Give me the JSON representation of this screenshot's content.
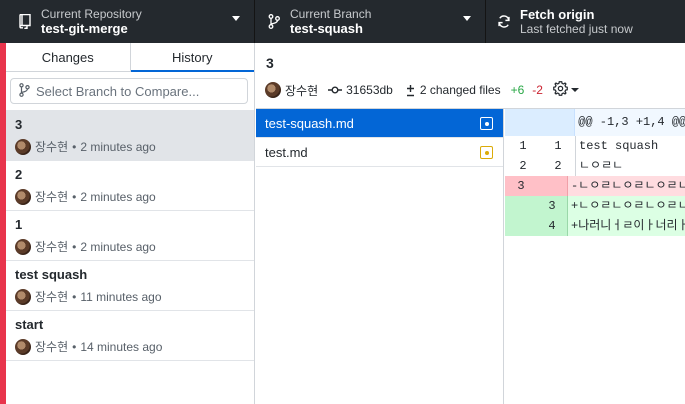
{
  "toolbar": {
    "repository": {
      "label": "Current Repository",
      "value": "test-git-merge"
    },
    "branch": {
      "label": "Current Branch",
      "value": "test-squash"
    },
    "fetch": {
      "label": "Fetch origin",
      "status": "Last fetched just now"
    }
  },
  "sidebar": {
    "tabs": [
      {
        "label": "Changes"
      },
      {
        "label": "History"
      }
    ],
    "compare": {
      "placeholder": "Select Branch to Compare..."
    },
    "commits": [
      {
        "title": "3",
        "author": "장수현",
        "time": "2 minutes ago"
      },
      {
        "title": "2",
        "author": "장수현",
        "time": "2 minutes ago"
      },
      {
        "title": "1",
        "author": "장수현",
        "time": "2 minutes ago"
      },
      {
        "title": "test squash",
        "author": "장수현",
        "time": "11 minutes ago"
      },
      {
        "title": "start",
        "author": "장수현",
        "time": "14 minutes ago"
      }
    ],
    "meta_separator": "•"
  },
  "commit": {
    "title": "3",
    "author": "장수현",
    "sha": "31653db",
    "changed_files": "2 changed files",
    "additions": "+6",
    "deletions": "-2"
  },
  "files": [
    {
      "name": "test-squash.md"
    },
    {
      "name": "test.md"
    }
  ],
  "diff": {
    "hunk_header": "@@ -1,3 +1,4 @@",
    "lines": [
      {
        "old": "1",
        "new": "1",
        "text": " test squash"
      },
      {
        "old": "2",
        "new": "2",
        "text": " ㄴㅇㄹㄴ"
      },
      {
        "old": "3",
        "new": "",
        "text": "-ㄴㅇㄹㄴㅇㄹㄴㅇㄹㄴㅇ"
      },
      {
        "old": "",
        "new": "3",
        "text": "+ㄴㅇㄹㄴㅇㄹㄴㅇㄹㄴㅇ"
      },
      {
        "old": "",
        "new": "4",
        "text": "+나러니ㅓㄹ이ㅏ너리ㅏ어"
      }
    ]
  },
  "colors": {
    "toolbar_bg": "#24292e",
    "accent": "#0366d6",
    "additions": "#28a745",
    "deletions": "#cb2431",
    "left_edge": "#e8344c"
  }
}
